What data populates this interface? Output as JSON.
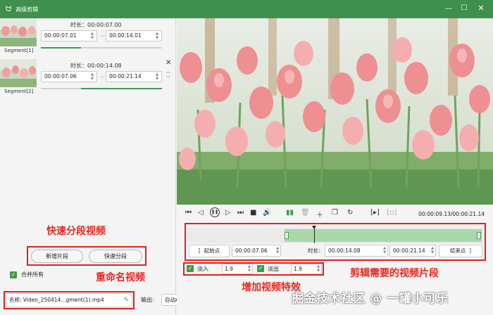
{
  "window": {
    "title": "高级剪辑",
    "min_glyph": "—",
    "max_glyph": "☐",
    "close_glyph": "✕",
    "accent": "#3f8f4f"
  },
  "segments": [
    {
      "label": "Segment[1]",
      "duration_text": "时长：00:00:07.00",
      "start": "00:00:07.01",
      "end": "00:00:14.01",
      "range_fraction": [
        0.0,
        0.33
      ]
    },
    {
      "label": "Segment[2]",
      "duration_text": "时长：00:00:14.08",
      "start": "00:00:07.06",
      "end": "00:00:21.14",
      "range_fraction": [
        0.33,
        1.0
      ]
    }
  ],
  "segment_separator": "—",
  "left_actions": {
    "annotation": "快速分段视频",
    "add_segment": "新增片段",
    "quick_segment": "快速分段",
    "merge_label": "合并所有",
    "merge_checked": true,
    "rename_annotation": "重命名视频",
    "name_label": "名称:",
    "name_value": "Video_250414...gment(1).mp4",
    "output_label": "输出:",
    "output_value": "自动Auto"
  },
  "player": {
    "time_readout": "00:00:09.13/00:00:21.14",
    "icons": [
      "skip-start-icon",
      "prev-frame-icon",
      "pause-icon",
      "next-frame-icon",
      "skip-end-icon",
      "volume-icon",
      "split-icon",
      "delete-icon",
      "add-icon",
      "copy-icon",
      "reset-icon",
      "crop-in-icon",
      "crop-out-icon"
    ]
  },
  "trim": {
    "annotation": "剪辑需要的视频片段",
    "start_button": "起始点",
    "start_value": "00:00:07.06",
    "duration_label": "时长：",
    "duration_value": "00:00:14.08",
    "end_value": "00:00:21.14",
    "end_button": "结束点",
    "selection_fraction": [
      0.33,
      1.0
    ],
    "playhead_fraction": 0.43
  },
  "effects": {
    "annotation": "增加视频特效",
    "fade_in_label": "淡入",
    "fade_in_value": "1.9",
    "fade_out_label": "淡出",
    "fade_out_value": "1.9"
  },
  "watermark": "掘金技术社区 @ 一罐小可乐"
}
